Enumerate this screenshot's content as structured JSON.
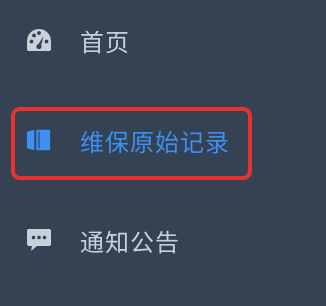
{
  "sidebar": {
    "items": [
      {
        "label": "首页",
        "icon": "dashboard-icon",
        "active": false
      },
      {
        "label": "维保原始记录",
        "icon": "book-icon",
        "active": true
      },
      {
        "label": "通知公告",
        "icon": "comment-icon",
        "active": false
      }
    ]
  },
  "colors": {
    "background": "#344253",
    "text": "#c8d0da",
    "active": "#3d8ff2",
    "highlight": "#e8322f"
  }
}
